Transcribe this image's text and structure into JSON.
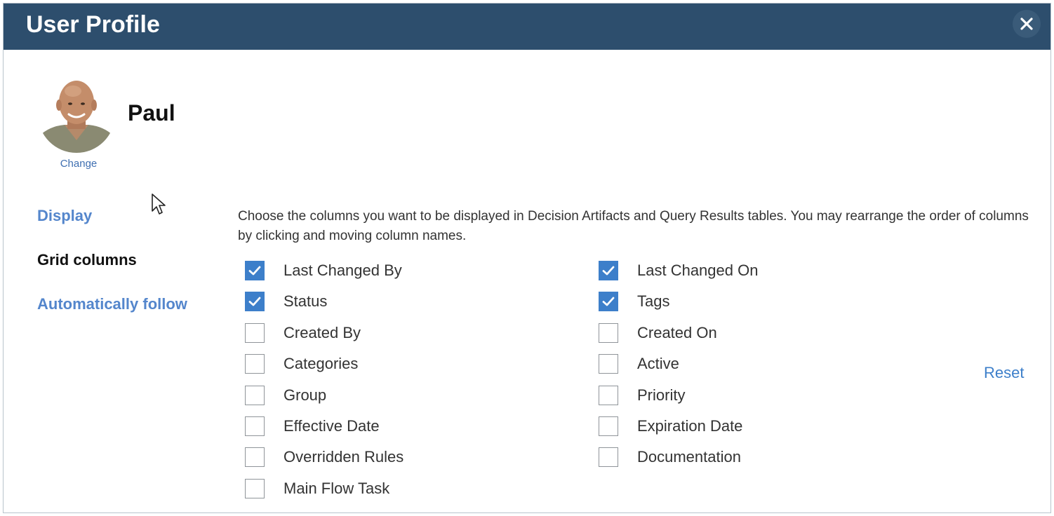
{
  "header": {
    "title": "User Profile"
  },
  "profile": {
    "name": "Paul",
    "change_label": "Change"
  },
  "nav": {
    "display": "Display",
    "grid_columns": "Grid columns",
    "automatically_follow": "Automatically follow",
    "active": "grid_columns"
  },
  "grid_columns": {
    "description": "Choose the columns you want to be displayed in Decision Artifacts and Query Results tables. You may rearrange the order of columns by clicking and moving column names.",
    "left": [
      {
        "label": "Last Changed By",
        "checked": true
      },
      {
        "label": "Status",
        "checked": true
      },
      {
        "label": "Created By",
        "checked": false
      },
      {
        "label": "Categories",
        "checked": false
      },
      {
        "label": "Group",
        "checked": false
      },
      {
        "label": "Effective Date",
        "checked": false
      },
      {
        "label": "Overridden Rules",
        "checked": false
      },
      {
        "label": "Main Flow Task",
        "checked": false
      }
    ],
    "right": [
      {
        "label": "Last Changed On",
        "checked": true
      },
      {
        "label": "Tags",
        "checked": true
      },
      {
        "label": "Created On",
        "checked": false
      },
      {
        "label": "Active",
        "checked": false
      },
      {
        "label": "Priority",
        "checked": false
      },
      {
        "label": "Expiration Date",
        "checked": false
      },
      {
        "label": "Documentation",
        "checked": false
      }
    ],
    "reset_label": "Reset"
  },
  "icons": {
    "close": "close-icon",
    "avatar": "avatar-photo",
    "cursor": "mouse-pointer-icon",
    "check": "checkmark-icon"
  },
  "colors": {
    "header_bg": "#2d4e6d",
    "link": "#5486cc",
    "checkbox_checked": "#3d7fca"
  }
}
